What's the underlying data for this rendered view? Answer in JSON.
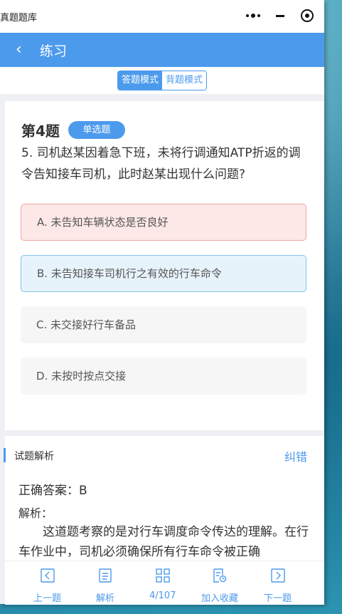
{
  "window": {
    "title": "真题题库"
  },
  "navbar": {
    "back_icon": "‹",
    "title": "练习"
  },
  "mode": {
    "options": [
      "答题模式",
      "背题模式"
    ],
    "active": 0
  },
  "question": {
    "number_label": "第4题",
    "type_badge": "单选题",
    "text": "5. 司机赵某因着急下班，未将行调通知ATP折返的调令告知接车司机，此时赵某出现什么问题?",
    "options": [
      {
        "label": "A. 未告知车辆状态是否良好",
        "state": "wrong"
      },
      {
        "label": "B. 未告知接车司机行之有效的行车命令",
        "state": "correct"
      },
      {
        "label": "C. 未交接好行车备品",
        "state": "normal"
      },
      {
        "label": "D. 未按时按点交接",
        "state": "normal"
      }
    ]
  },
  "analysis": {
    "title": "试题解析",
    "fix_label": "纠错",
    "answer": "正确答案：B",
    "explain_label": "解析：",
    "explain_text": "这道题考察的是对行车调度命令传达的理解。在行车作业中，司机必须确保所有行车命令被正确"
  },
  "toolbar": {
    "items": [
      {
        "label": "上一题",
        "icon": "prev-icon"
      },
      {
        "label": "解析",
        "icon": "document-icon"
      },
      {
        "label": "4/107",
        "icon": "grid-icon"
      },
      {
        "label": "加入收藏",
        "icon": "favorite-doc-icon"
      },
      {
        "label": "下一题",
        "icon": "next-icon"
      }
    ]
  },
  "colors": {
    "accent": "#4c9aec",
    "wrong_bg": "#fbe8e7",
    "wrong_border": "#f1a8a3",
    "correct_bg": "#e7f3fb",
    "correct_border": "#83c3e6"
  }
}
